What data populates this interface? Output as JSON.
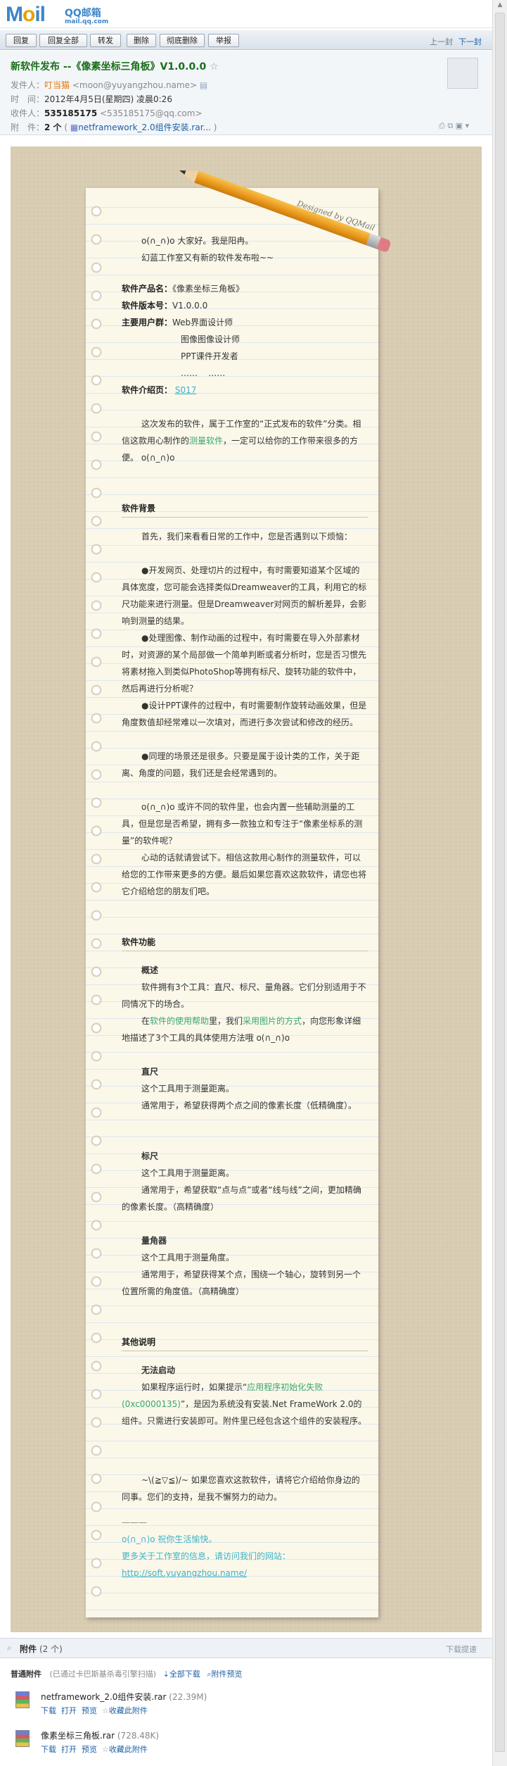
{
  "logo": {
    "mail": "Mail",
    "qq": "QQ邮箱",
    "domain": "mail.qq.com"
  },
  "toolbar": {
    "reply": "回复",
    "reply_all": "回复全部",
    "forward": "转发",
    "delete": "删除",
    "delete_forever": "彻底删除",
    "report": "举报",
    "prev": "上一封",
    "next": "下一封"
  },
  "header": {
    "subject": "新软件发布 --《像素坐标三角板》V1.0.0.0",
    "sender_label": "发件人：",
    "sender_name": "叮当猫",
    "sender_email": "<moon@yuyangzhou.name>",
    "time_label": "时　间：",
    "time_value": "2012年4月5日(星期四) 凌晨0:26",
    "to_label": "收件人：",
    "to_name": "535185175",
    "to_email": "<535185175@qq.com>",
    "att_label": "附　件：",
    "att_count": "2 个",
    "att_file": "netframework_2.0组件安装.rar..."
  },
  "paper": {
    "designed": "Designed by QQMail"
  },
  "content": {
    "greet1": "o(∩_∩)o  大家好。我是阳冉。",
    "greet2": "幻蓝工作室又有新的软件发布啦~~",
    "name_label": "软件产品名：",
    "name_value": "《像素坐标三角板》",
    "version_label": "软件版本号：",
    "version_value": "V1.0.0.0",
    "users_label": "主要用户群：",
    "users_1": "Web界面设计师",
    "users_2": "图像图像设计师",
    "users_3": "PPT课件开发者",
    "users_4": "……    ……",
    "intro_label": "软件介绍页：",
    "intro_link": "S017",
    "p1": "这次发布的软件，属于工作室的“正式发布的软件”分类。相信这款用心制作的",
    "p1_green": "测量软件",
    "p1_end": "，一定可以给你的工作带来很多的方便。 o(∩_∩)o",
    "bg_title": "软件背景",
    "bg1": "首先，我们来看看日常的工作中，您是否遇到以下烦恼：",
    "bg2": "●开发网页、处理切片的过程中，有时需要知道某个区域的具体宽度，您可能会选择类似Dreamweaver的工具，利用它的标尺功能来进行测量。但是Dreamweaver对网页的解析差异，会影响到测量的结果。",
    "bg3": "●处理图像、制作动画的过程中，有时需要在导入外部素材时，对资源的某个局部做一个简单判断或者分析时，您是否习惯先将素材拖入到类似PhotoShop等拥有标尺、旋转功能的软件中，然后再进行分析呢？",
    "bg4": "●设计PPT课件的过程中，有时需要制作旋转动画效果，但是角度数值却经常难以一次填对，而进行多次尝试和修改的经历。",
    "bg5": "●同理的场景还是很多。只要是属于设计类的工作，关于距离、角度的问题，我们还是会经常遇到的。",
    "bg6": "o(∩_∩)o 或许不同的软件里，也会内置一些辅助测量的工具，但是您是否希望，拥有多一款独立和专注于“像素坐标系的测量”的软件呢？",
    "bg7": "心动的话就请尝试下。相信这款用心制作的测量软件，可以给您的工作带来更多的方便。最后如果您喜欢这款软件，请您也将它介绍给您的朋友们吧。",
    "fn_title": "软件功能",
    "ov_title": "概述",
    "ov1": "软件拥有3个工具：直尺、标尺、量角器。它们分别适用于不同情况下的场合。",
    "ov2a": "在",
    "ov2_green1": "软件的使用帮助",
    "ov2b": "里，我们",
    "ov2_green2": "采用图片的方式",
    "ov2c": "，向您形象详细地描述了3个工具的具体使用方法哦  o(∩_∩)o",
    "ruler_title": "直尺",
    "ruler1": "这个工具用于测量距离。",
    "ruler2": "通常用于，希望获得两个点之间的像素长度（低精确度）。",
    "scale_title": "标尺",
    "scale1": "这个工具用于测量距离。",
    "scale2": "通常用于，希望获取“点与点”或者“线与线”之间，更加精确的像素长度。（高精确度）",
    "prot_title": "量角器",
    "prot1": "这个工具用于测量角度。",
    "prot2": "通常用于，希望获得某个点，围绕一个轴心，旋转到另一个位置所需的角度值。（高精确度）",
    "other_title": "其他说明",
    "nostart_title": "无法启动",
    "ns_a": "如果程序运行时，如果提示“",
    "ns_green": "应用程序初始化失败(0xc0000135)",
    "ns_b": "”，是因为系统没有安装.Net FrameWork 2.0的组件。只需进行安装即可。附件里已经包含这个组件的安装程序。",
    "thanks": "~\\(≧▽≦)/~ 如果您喜欢这款软件，请将它介绍给你身边的同事。您们的支持，是我不懈努力的动力。",
    "dash": "———",
    "sign1": "o(∩_∩)o  祝你生活愉快。",
    "sign2": "更多关于工作室的信息，请访问我们的网站：",
    "site": "http://soft.yuyangzhou.name/"
  },
  "attachments": {
    "title": "附件",
    "count": "(2 个)",
    "download_hint": "下载提速",
    "normal": "普通附件",
    "scan": "(已通过卡巴斯基杀毒引擎扫描)",
    "download_all": "全部下载",
    "preview_all": "附件预览",
    "files": [
      {
        "name": "netframework_2.0组件安装.rar",
        "size": "(22.39M)"
      },
      {
        "name": "像素坐标三角板.rar",
        "size": "(728.48K)"
      }
    ],
    "act_download": "下载",
    "act_open": "打开",
    "act_preview": "预览",
    "act_collect": "收藏此附件"
  }
}
